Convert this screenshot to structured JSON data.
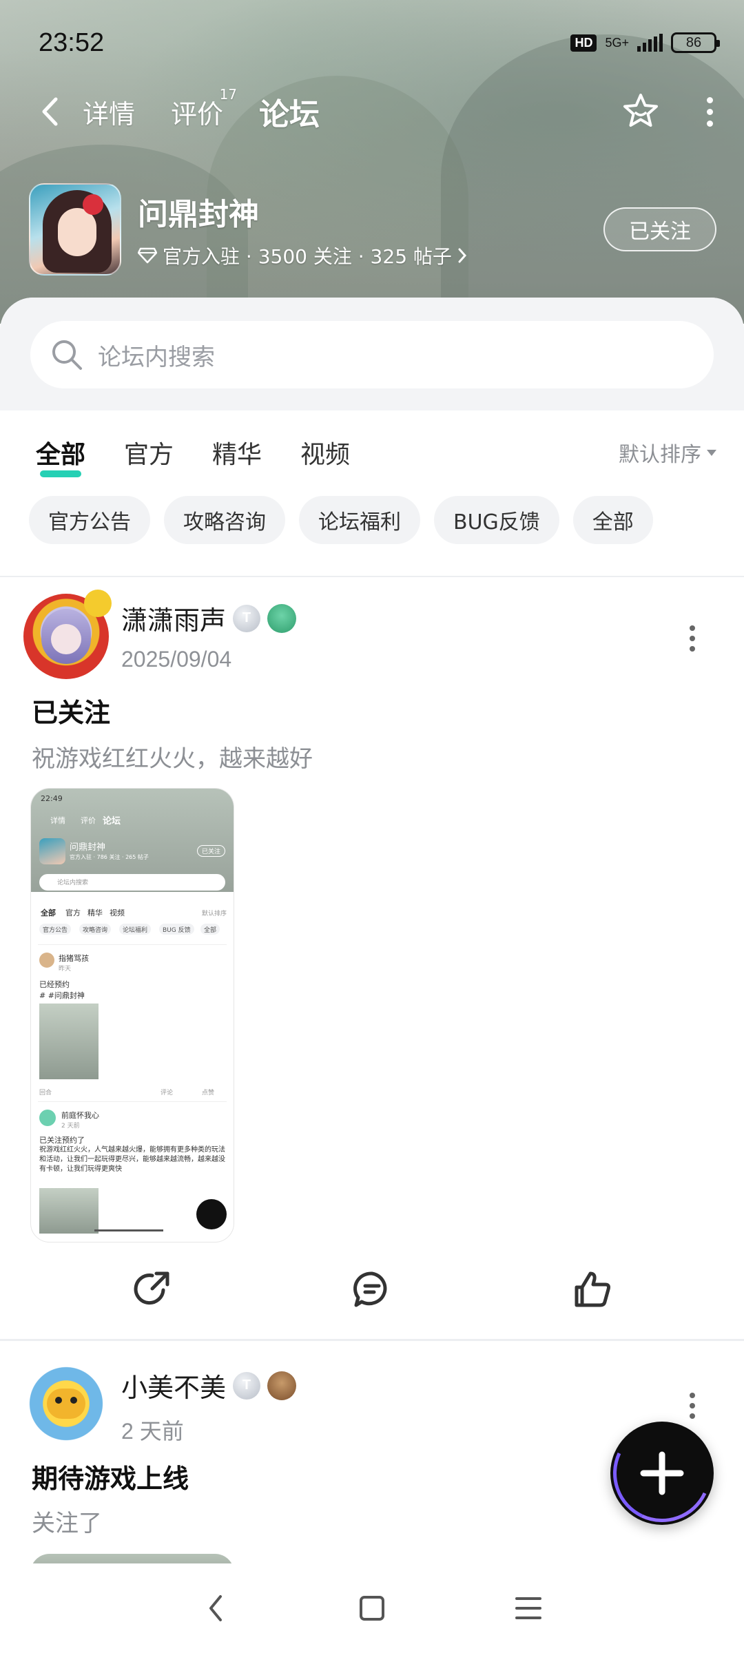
{
  "status_bar": {
    "time": "23:52",
    "hd": "HD",
    "network": "5G+",
    "battery": "86"
  },
  "nav": {
    "tabs": [
      {
        "label": "详情"
      },
      {
        "label": "评价",
        "count": "17"
      },
      {
        "label": "论坛"
      }
    ],
    "accent_color": "#25d0b4"
  },
  "app": {
    "name": "问鼎封神",
    "meta": "官方入驻 · 3500 关注 · 325 帖子",
    "follow_label": "已关注"
  },
  "search": {
    "placeholder": "论坛内搜索"
  },
  "filters": {
    "tabs": [
      "全部",
      "官方",
      "精华",
      "视频"
    ],
    "sort_label": "默认排序",
    "chips": [
      "官方公告",
      "攻略咨询",
      "论坛福利",
      "BUG反馈",
      "全部"
    ]
  },
  "posts": [
    {
      "author": "潇潇雨声",
      "badge": "T",
      "date": "2025/09/04",
      "title": "已关注",
      "body": "祝游戏红红火火，越来越好",
      "screenshot": {
        "time": "22:49",
        "tabs": [
          "详情",
          "评价",
          "论坛"
        ],
        "app_name": "问鼎封神",
        "app_meta": "官方入驻 · 786 关注 · 265 帖子",
        "follow": "已关注",
        "search": "论坛内搜索",
        "filter_tabs": [
          "全部",
          "官方",
          "精华",
          "视频"
        ],
        "sort": "默认排序",
        "chips": [
          "官方公告",
          "攻略咨询",
          "论坛福利",
          "BUG 反馈",
          "全部"
        ],
        "post1_author": "指猪骂孩",
        "post1_date": "昨天",
        "post1_title": "已经预约",
        "post1_tag": "# #问鼎封神",
        "post1_footer_left": "回合",
        "post1_comment": "评论",
        "post1_like": "点赞",
        "post2_author": "前庭怀我心",
        "post2_date": "2 天前",
        "post2_title": "已关注预约了",
        "post2_body": "祝游戏红红火火，人气越来越火爆，能够拥有更多种类的玩法和活动，让我们一起玩得更尽兴，能够越来越流畅，越来越没有卡顿，让我们玩得更爽快"
      }
    },
    {
      "author": "小美不美",
      "badge": "T",
      "date": "2 天前",
      "title": "期待游戏上线",
      "body": "关注了"
    }
  ],
  "icons": {
    "back": "chevron-left-icon",
    "favorite": "star-face-icon",
    "more": "more-vertical-icon",
    "share": "share-icon",
    "comment": "comment-icon",
    "like": "thumbs-up-icon",
    "fab": "plus-icon"
  }
}
